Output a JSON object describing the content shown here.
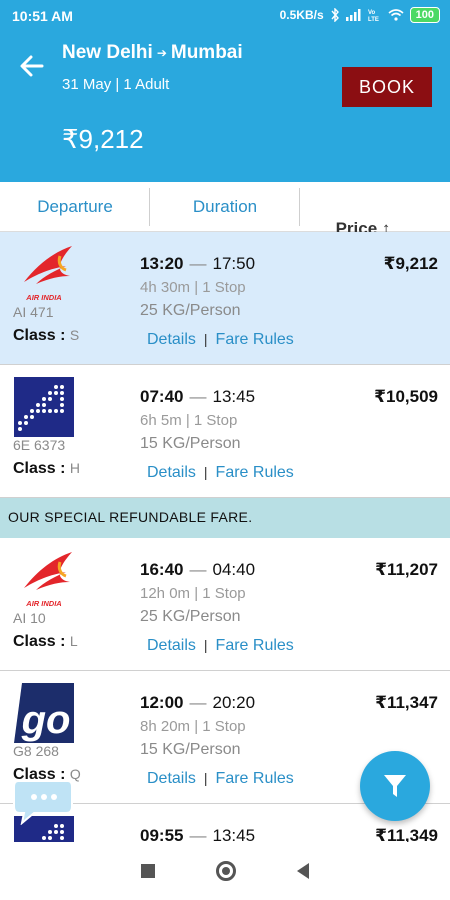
{
  "status_bar": {
    "time": "10:51 AM",
    "network_speed": "0.5KB/s",
    "battery": "100",
    "icons": [
      "bluetooth-icon",
      "signal-icon",
      "volte-icon",
      "wifi-icon",
      "battery-icon"
    ]
  },
  "header": {
    "origin": "New Delhi",
    "destination": "Mumbai",
    "trip_info": "31 May | 1 Adult",
    "total_price": "₹9,212",
    "book_label": "BOOK"
  },
  "sort": {
    "departure": "Departure",
    "duration": "Duration",
    "price": "Price ↑"
  },
  "flights": [
    {
      "airline_logo": "air-india-logo",
      "flight_code": "AI 471",
      "class_label": "Class :",
      "class_value": "S",
      "depart": "13:20",
      "arrive": "17:50",
      "duration": "4h 30m | 1 Stop",
      "baggage": "25 KG/Person",
      "price": "₹9,212",
      "details": "Details",
      "fare_rules": "Fare Rules",
      "selected": true
    },
    {
      "airline_logo": "indigo-logo",
      "flight_code": "6E 6373",
      "class_label": "Class :",
      "class_value": "H",
      "depart": "07:40",
      "arrive": "13:45",
      "duration": "6h 5m | 1 Stop",
      "baggage": "15  KG/Person",
      "price": "₹10,509",
      "details": "Details",
      "fare_rules": "Fare Rules",
      "selected": false
    },
    {
      "airline_logo": "air-india-logo",
      "flight_code": "AI 10",
      "class_label": "Class :",
      "class_value": "L",
      "depart": "16:40",
      "arrive": "04:40",
      "duration": "12h 0m | 1 Stop",
      "baggage": "25 KG/Person",
      "price": "₹11,207",
      "details": "Details",
      "fare_rules": "Fare Rules",
      "selected": false
    },
    {
      "airline_logo": "goair-logo",
      "flight_code": "G8 268",
      "class_label": "Class :",
      "class_value": "Q",
      "depart": "12:00",
      "arrive": "20:20",
      "duration": "8h 20m | 1 Stop",
      "baggage": "15  KG/Person",
      "price": "₹11,347",
      "details": "Details",
      "fare_rules": "Fare Rules",
      "selected": false
    },
    {
      "airline_logo": "indigo-logo",
      "depart": "09:55",
      "arrive": "13:45",
      "price": "₹11,349"
    }
  ],
  "banner": "OUR  SPECIAL REFUNDABLE FARE.",
  "colors": {
    "primary": "#2aa8de",
    "book_button": "#8b0e12",
    "selected_row": "#d9ebfb",
    "banner": "#b8dfe4",
    "link": "#2a8fc7"
  }
}
